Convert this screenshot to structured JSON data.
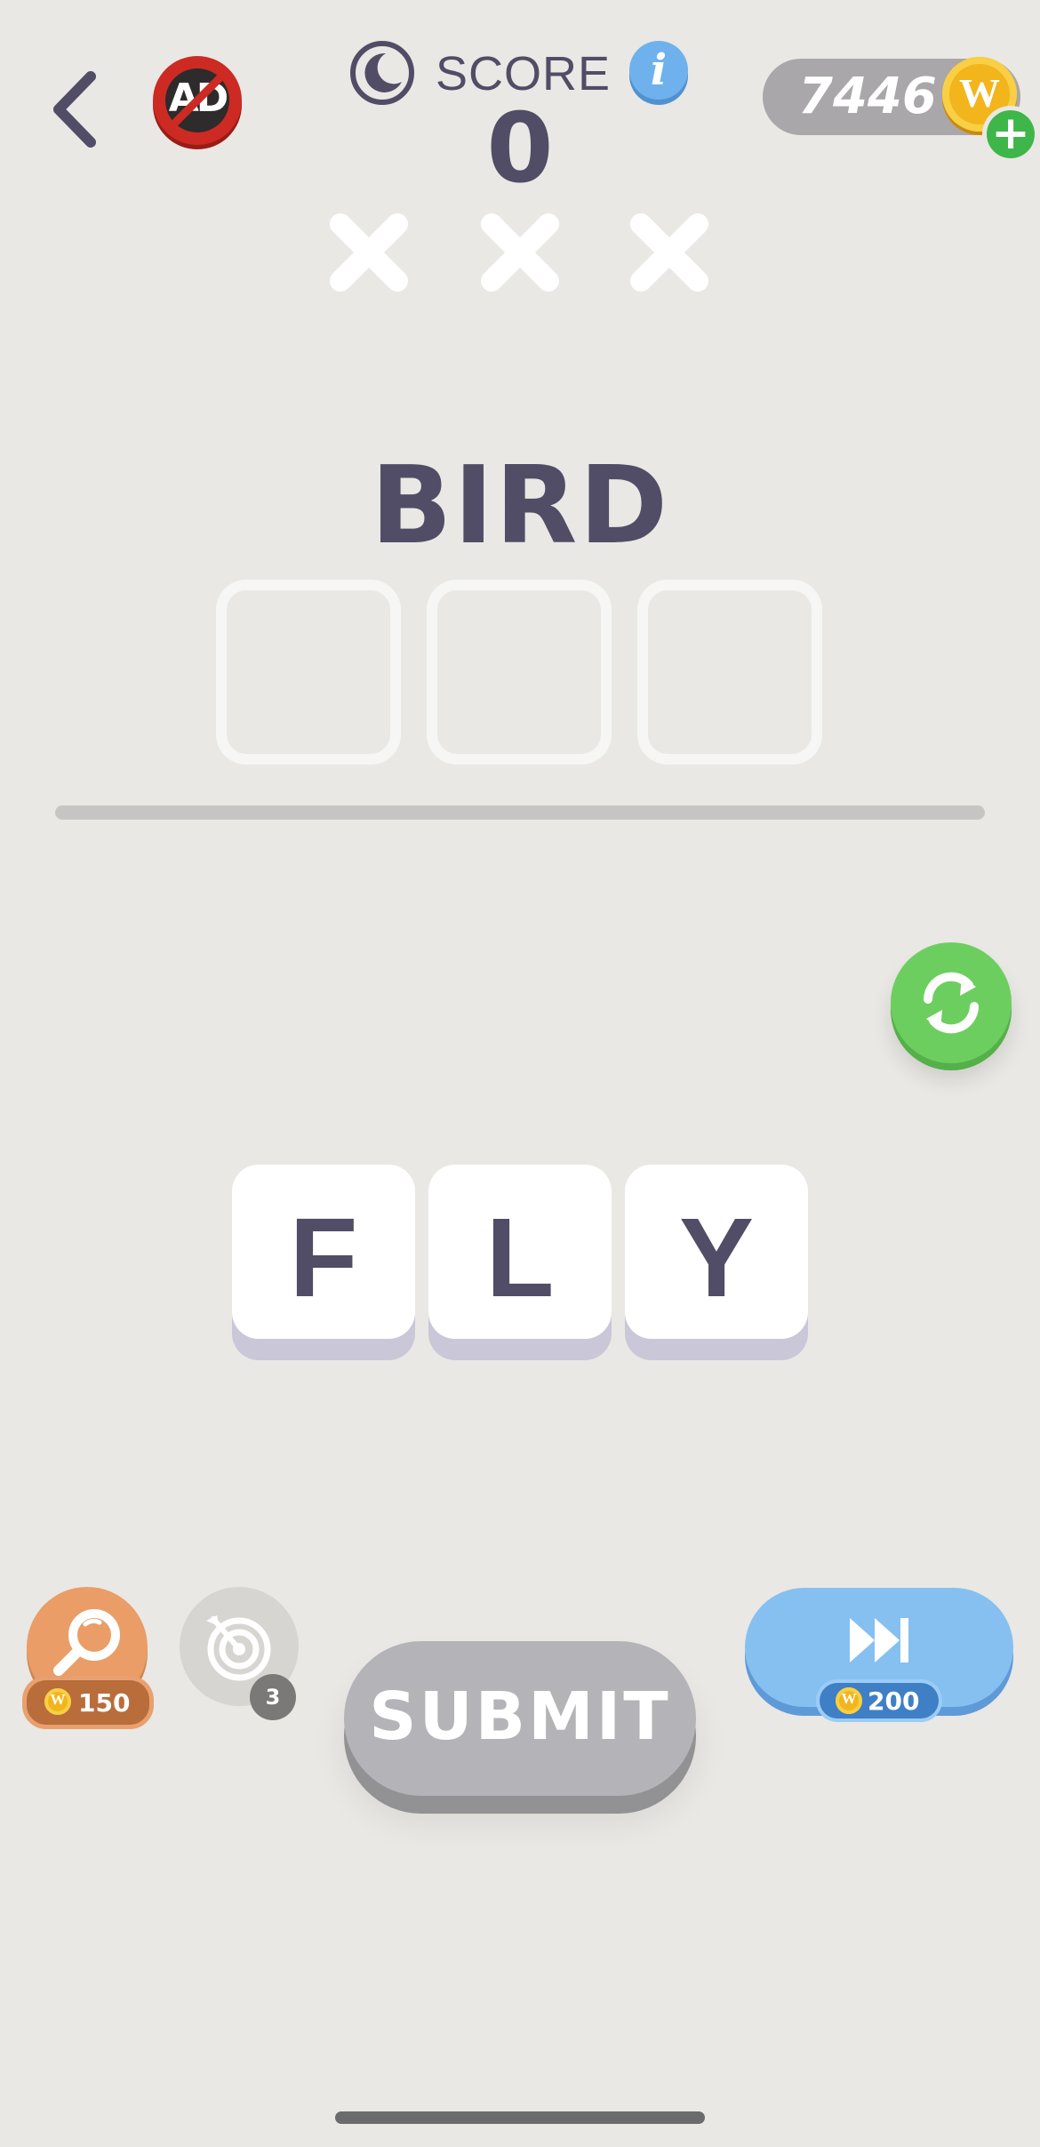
{
  "header": {
    "score_label": "SCORE",
    "score_value": "0",
    "coin_count": "7446",
    "ad_label": "AD",
    "info_label": "i",
    "coin_symbol": "W",
    "plus_label": "+",
    "lives_remaining": 0,
    "lives_total": 3
  },
  "puzzle": {
    "clue_word": "BIRD",
    "answer_slots": [
      "",
      "",
      ""
    ],
    "letter_tiles": [
      "F",
      "L",
      "Y"
    ]
  },
  "controls": {
    "hint_cost": "150",
    "target_count": "3",
    "submit_label": "SUBMIT",
    "skip_cost": "200"
  },
  "colors": {
    "background": "#e9e8e4",
    "text": "#514d66",
    "shuffle": "#6dce60",
    "skip": "#86c0f1",
    "hint": "#ea9d67",
    "submit_disabled": "#b4b3b7"
  },
  "icons": {
    "back": "back-chevron-icon",
    "no_ads": "no-ads-icon",
    "night_mode": "moon-icon",
    "info": "info-icon",
    "coin": "coin-icon",
    "add_coins": "plus-icon",
    "strike": "strike-x-icon",
    "shuffle": "shuffle-icon",
    "hint": "magnifier-icon",
    "target": "target-icon",
    "skip": "fast-forward-icon"
  }
}
